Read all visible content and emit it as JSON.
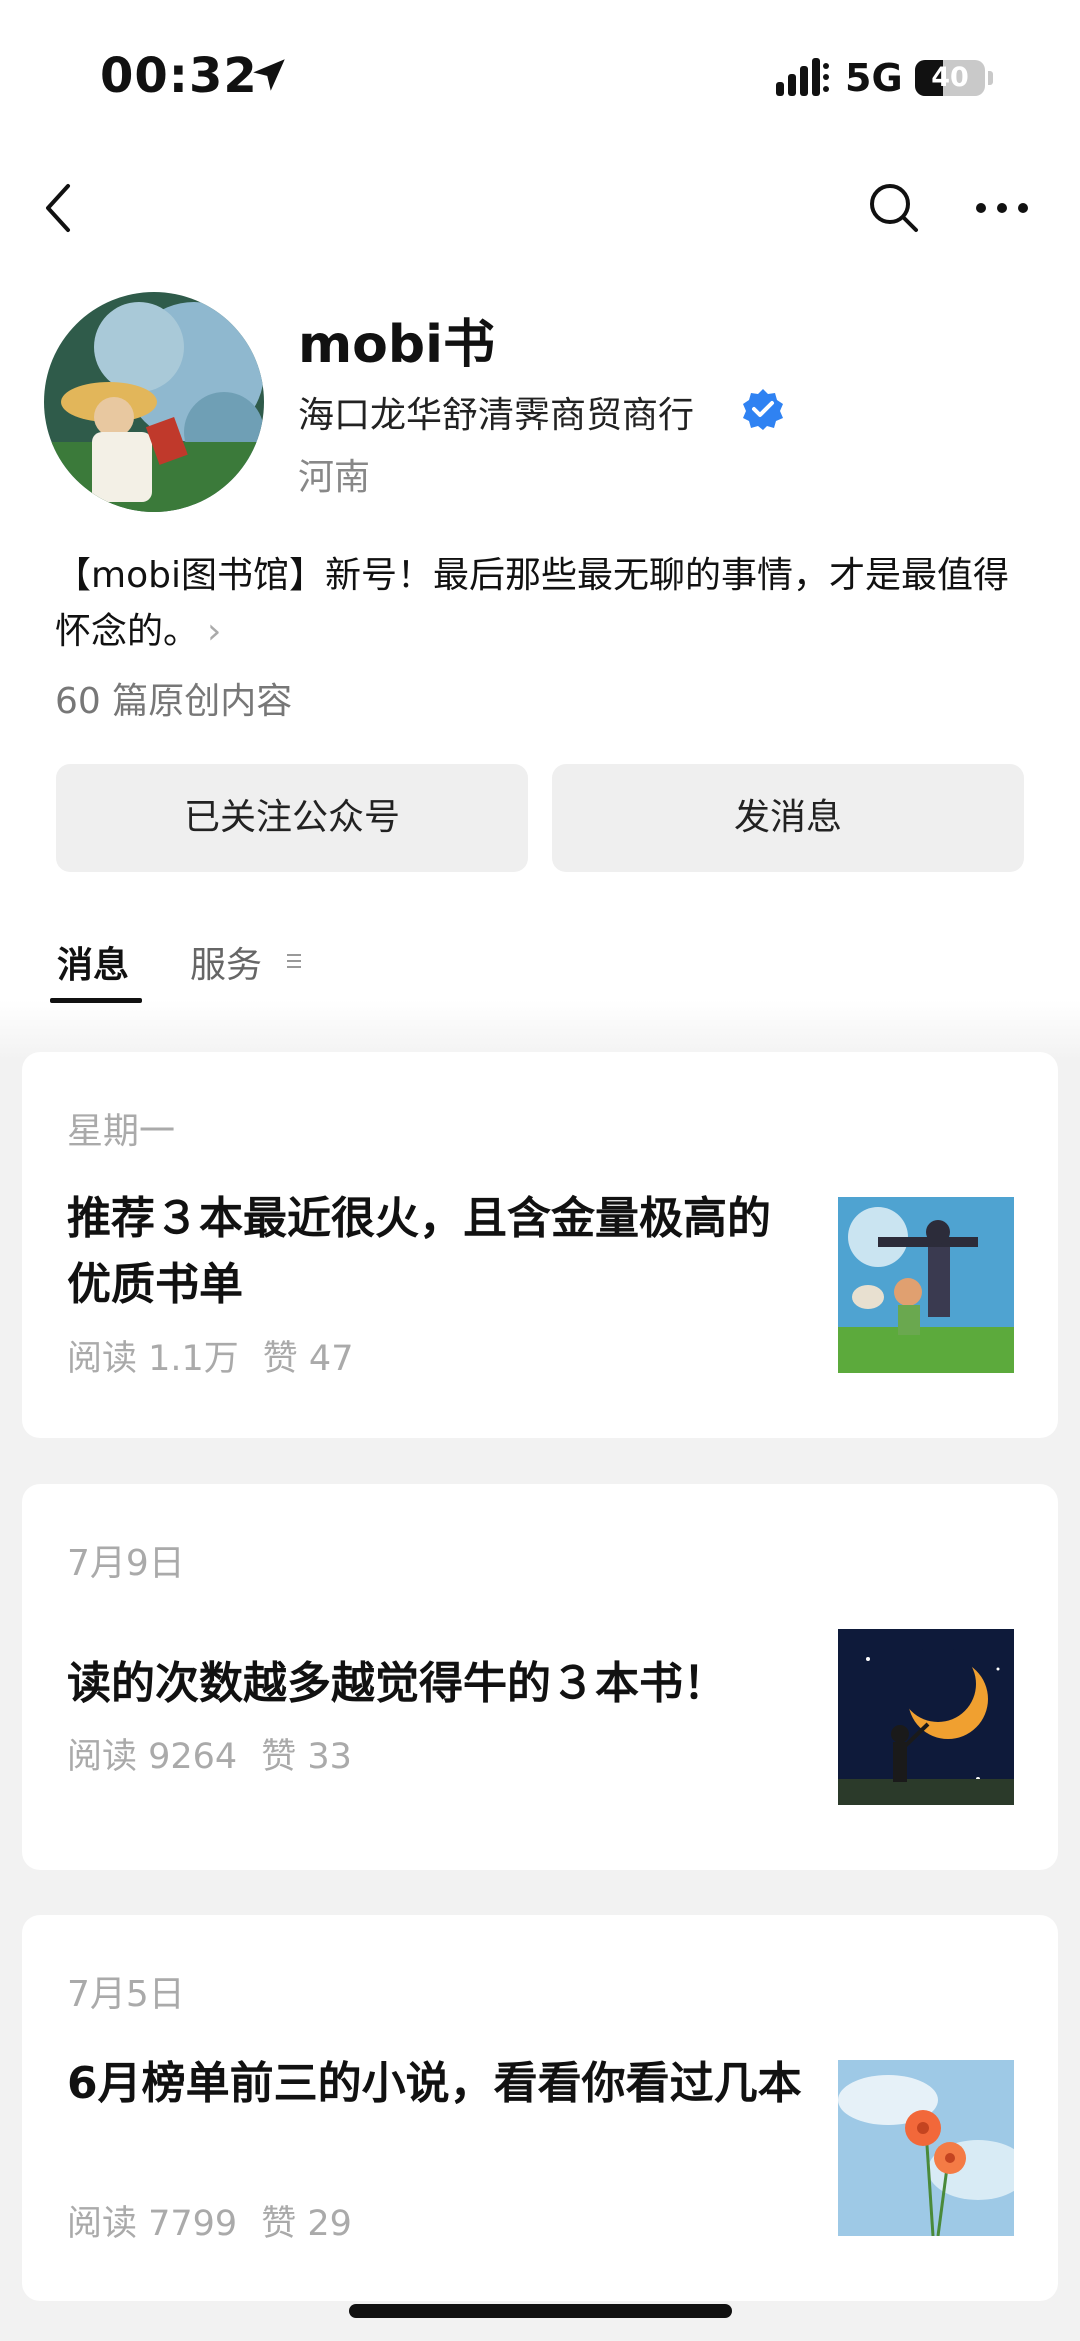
{
  "status_bar": {
    "time": "00:32",
    "network": "5G",
    "battery": "40",
    "battery_fraction": 0.4
  },
  "nav": {
    "back_icon": "back-chevron-icon",
    "search_icon": "search-icon",
    "more_icon": "more-dots-icon"
  },
  "profile": {
    "name": "mobi书",
    "company": "海口龙华舒清霁商贸商行",
    "region": "河南",
    "description": "【mobi图书馆】新号！最后那些最无聊的事情，才是最值得怀念的。",
    "description_chevron": "›",
    "original_count": "60 篇原创内容",
    "verified_color": "#2f82f2"
  },
  "actions": {
    "follow_label": "已关注公众号",
    "message_label": "发消息"
  },
  "tabs": {
    "messages": "消息",
    "services": "服务"
  },
  "articles": [
    {
      "date": "星期一",
      "title": "推荐３本最近很火，且含金量极高的优质书单",
      "reads": "阅读 1.1万",
      "likes": "赞 47"
    },
    {
      "date": "7月9日",
      "title": "读的次数越多越觉得牛的３本书！",
      "reads": "阅读 9264",
      "likes": "赞 33"
    },
    {
      "date": "7月5日",
      "title": "6月榜单前三的小说，看看你看过几本",
      "reads": "阅读 7799",
      "likes": "赞 29"
    }
  ]
}
